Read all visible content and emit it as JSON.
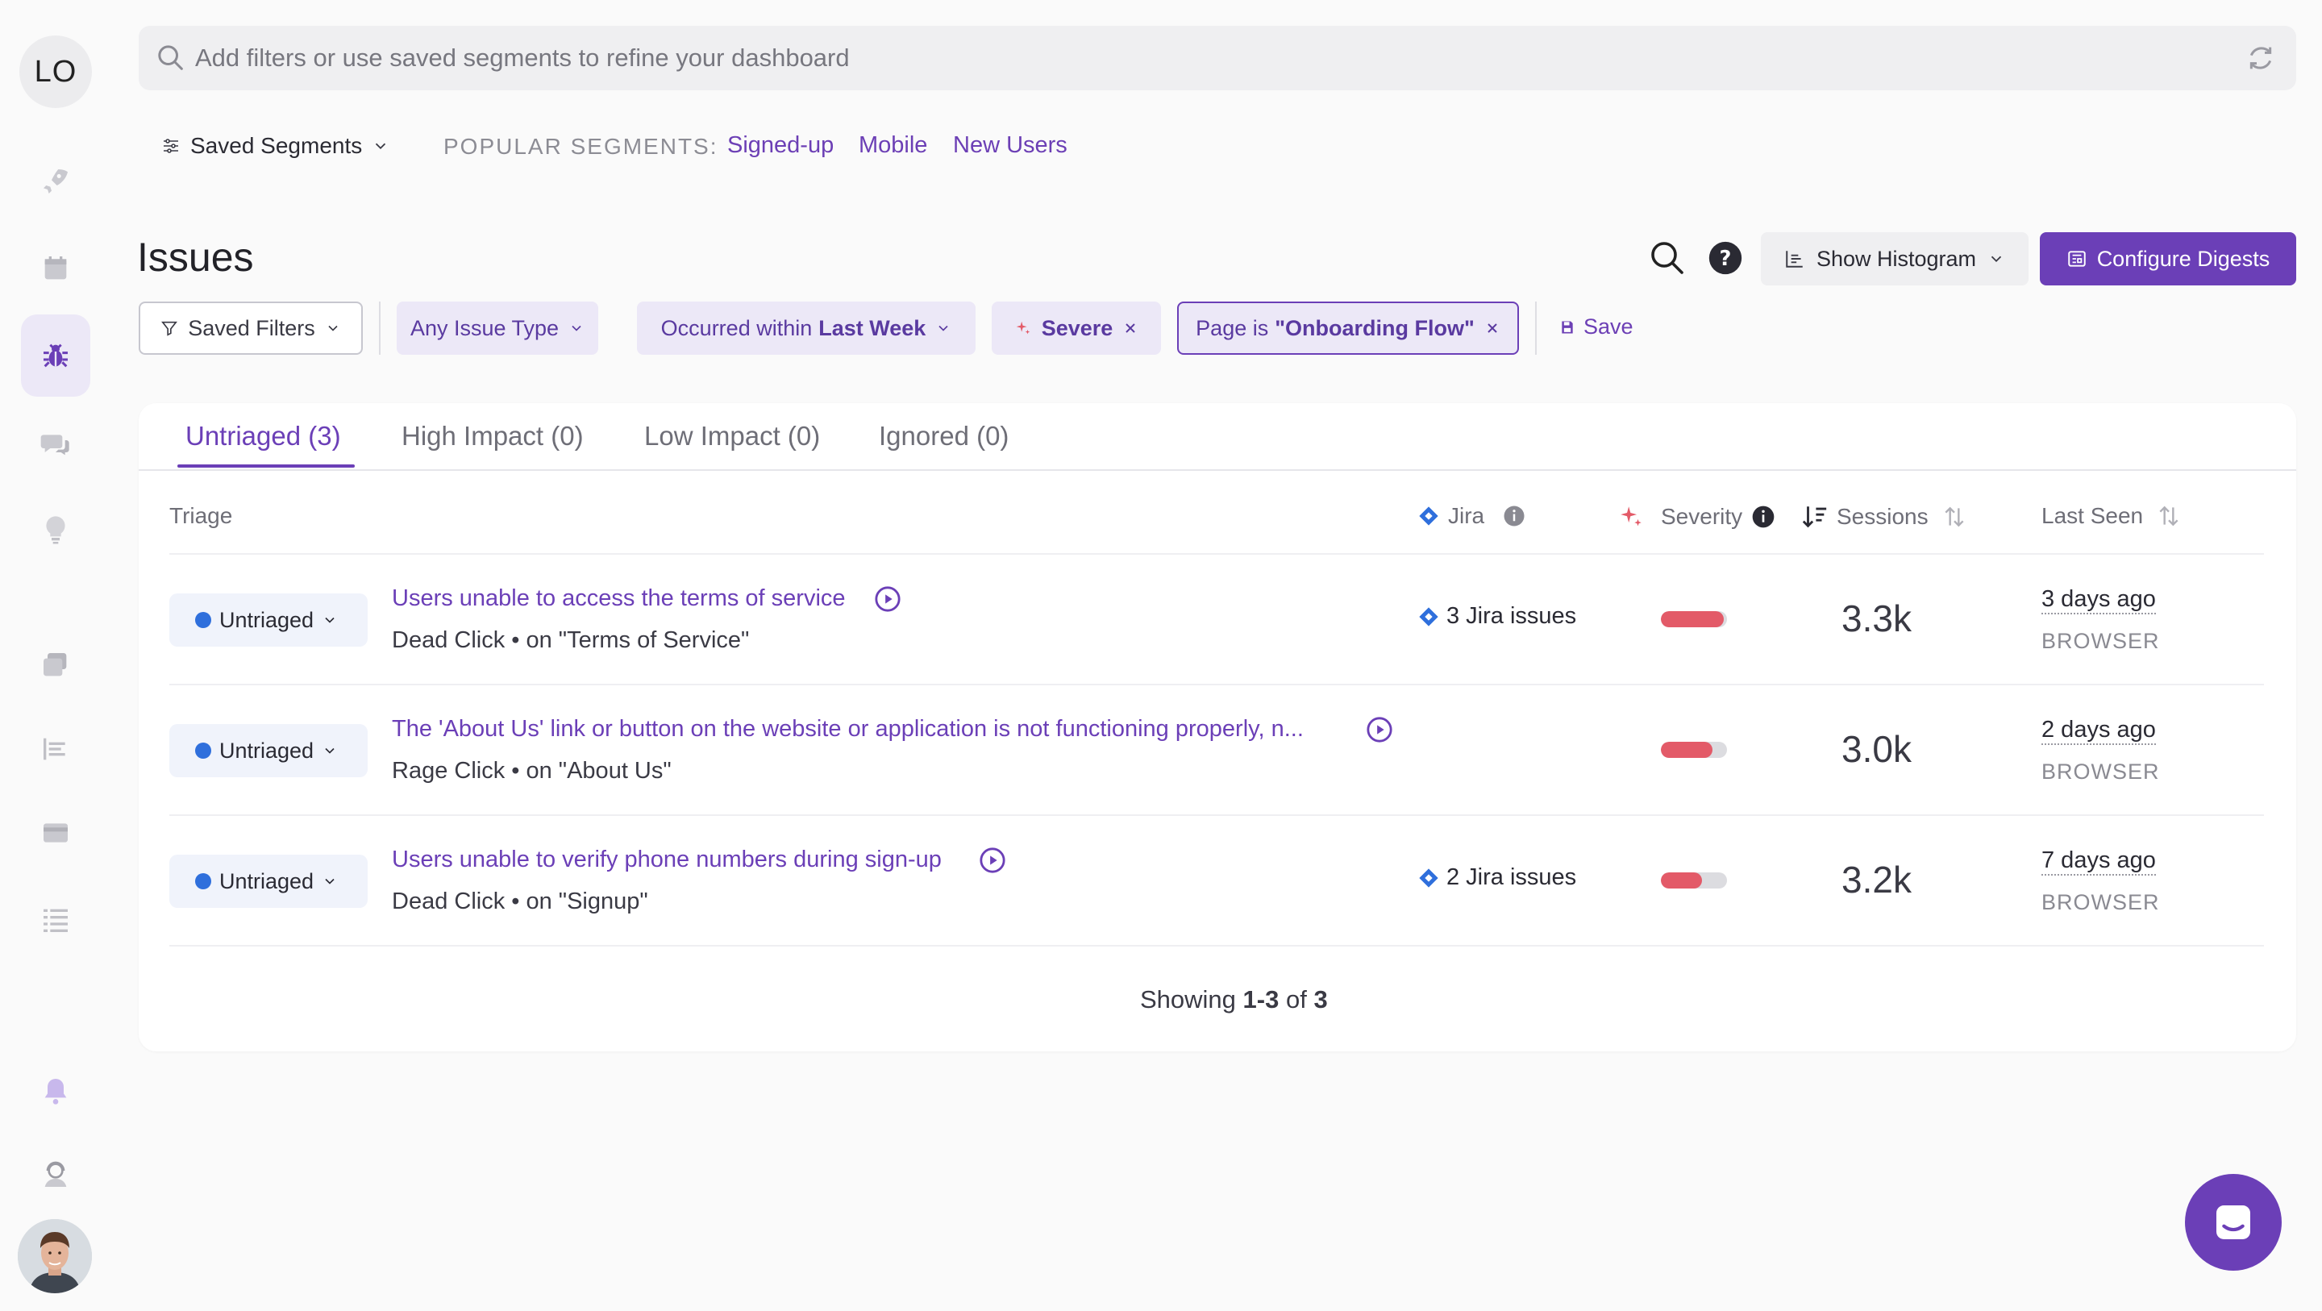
{
  "sidebar": {
    "account_initials": "LO",
    "nav_items": [
      {
        "icon": "rocket-icon"
      },
      {
        "icon": "calendar-icon"
      },
      {
        "icon": "bug-icon",
        "active": true
      },
      {
        "icon": "chat-bubbles-icon"
      },
      {
        "icon": "lightbulb-icon"
      },
      {
        "icon": "stack-icon"
      },
      {
        "icon": "list-icon"
      },
      {
        "icon": "card-icon"
      },
      {
        "icon": "checklist-icon"
      },
      {
        "icon": "bell-icon"
      },
      {
        "icon": "support-agent-icon"
      }
    ]
  },
  "search": {
    "placeholder": "Add filters or use saved segments to refine your dashboard"
  },
  "segments": {
    "saved_label": "Saved Segments",
    "popular_label": "POPULAR SEGMENTS:",
    "popular": [
      "Signed-up",
      "Mobile",
      "New Users"
    ]
  },
  "header": {
    "title": "Issues",
    "histogram_label": "Show Histogram",
    "digest_label": "Configure Digests"
  },
  "filters": {
    "saved_filters_label": "Saved Filters",
    "issue_type_label": "Any Issue Type",
    "occurred_prefix": "Occurred within",
    "occurred_value": "Last Week",
    "severity_label": "Severe",
    "page_prefix": "Page is",
    "page_value": "\"Onboarding Flow\"",
    "save_label": "Save"
  },
  "tabs": [
    {
      "label": "Untriaged (3)",
      "active": true
    },
    {
      "label": "High Impact (0)"
    },
    {
      "label": "Low Impact (0)"
    },
    {
      "label": "Ignored (0)"
    }
  ],
  "table": {
    "headers": {
      "triage": "Triage",
      "jira": "Jira",
      "severity": "Severity",
      "sessions": "Sessions",
      "last_seen": "Last Seen"
    },
    "rows": [
      {
        "triage": "Untriaged",
        "title": "Users unable to access the terms of service",
        "subtitle": "Dead Click • on \"Terms of Service\"",
        "jira": "3 Jira issues",
        "severity": 0.95,
        "sessions": "3.3k",
        "last_seen": "3 days ago",
        "platform": "BROWSER"
      },
      {
        "triage": "Untriaged",
        "title": "The 'About Us' link or button on the website or application is not functioning properly, n...",
        "subtitle": "Rage Click • on \"About Us\"",
        "jira": "",
        "severity": 0.78,
        "sessions": "3.0k",
        "last_seen": "2 days ago",
        "platform": "BROWSER"
      },
      {
        "triage": "Untriaged",
        "title": "Users unable to verify phone numbers during sign-up",
        "subtitle": "Dead Click • on \"Signup\"",
        "jira": "2 Jira issues",
        "severity": 0.62,
        "sessions": "3.2k",
        "last_seen": "7 days ago",
        "platform": "BROWSER"
      }
    ]
  },
  "pagination": {
    "prefix": "Showing",
    "range": "1-3",
    "of": "of",
    "total": "3"
  },
  "colors": {
    "accent": "#6b3fb7",
    "severity": "#e35a68",
    "jira": "#2f6fdc"
  }
}
